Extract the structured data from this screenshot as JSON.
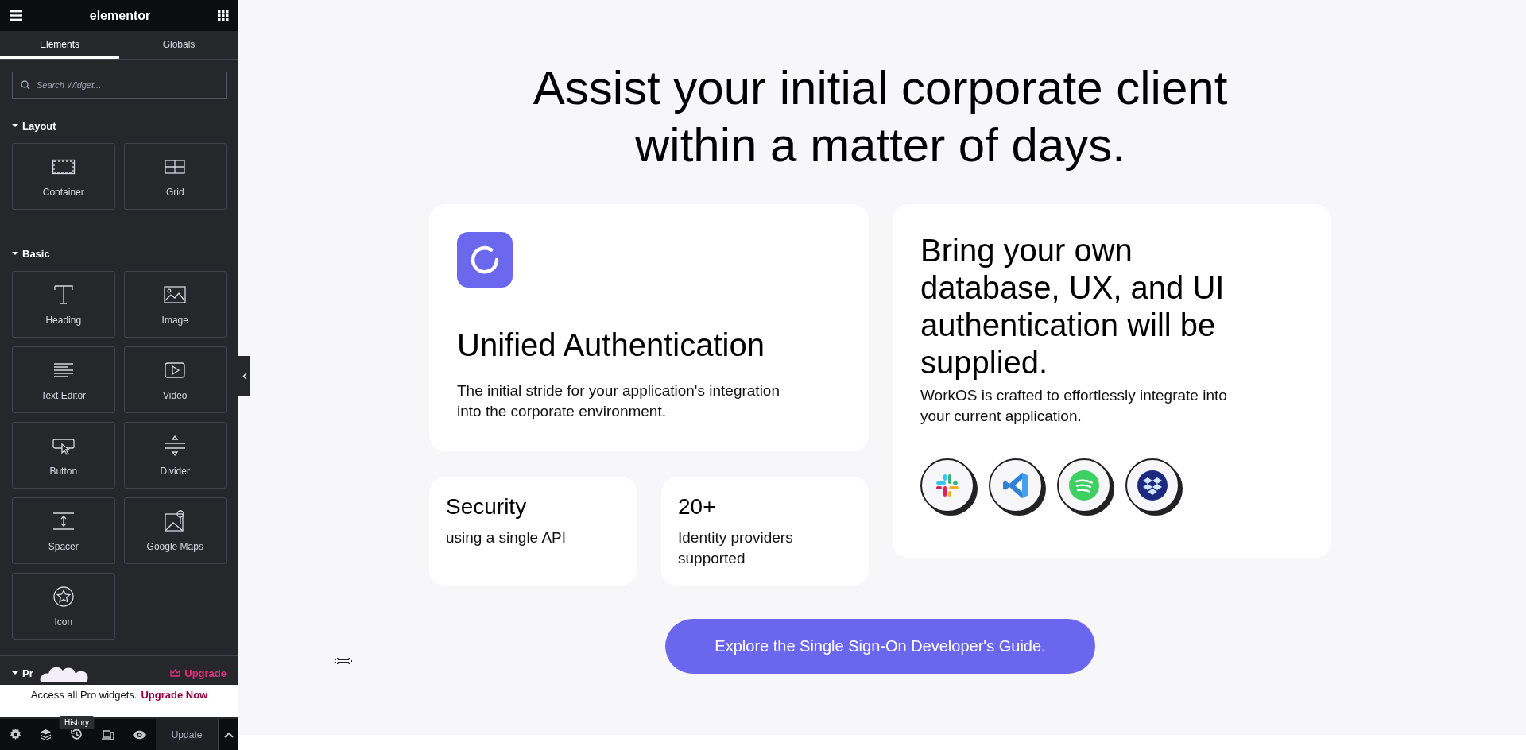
{
  "editor": {
    "logo": "elementor",
    "tabs": [
      {
        "label": "Elements",
        "selected": true
      },
      {
        "label": "Globals",
        "selected": false
      }
    ],
    "search": {
      "placeholder": "Search Widget..."
    },
    "sections": [
      {
        "title": "Layout",
        "expanded": true,
        "widgets": [
          {
            "label": "Container",
            "kind": "container"
          },
          {
            "label": "Grid",
            "kind": "grid"
          }
        ]
      },
      {
        "title": "Basic",
        "expanded": true,
        "widgets": [
          {
            "label": "Heading",
            "kind": "heading"
          },
          {
            "label": "Image",
            "kind": "image"
          },
          {
            "label": "Text Editor",
            "kind": "text"
          },
          {
            "label": "Video",
            "kind": "video"
          },
          {
            "label": "Button",
            "kind": "button"
          },
          {
            "label": "Divider",
            "kind": "divider"
          },
          {
            "label": "Spacer",
            "kind": "spacer"
          },
          {
            "label": "Google Maps",
            "kind": "maps"
          },
          {
            "label": "Icon",
            "kind": "icon"
          }
        ]
      }
    ],
    "pro_section": {
      "title": "Pr",
      "upgrade": "Upgrade"
    },
    "promo": {
      "text": "Access all Pro widgets.",
      "link": "Upgrade Now"
    },
    "tooltip": "History",
    "footer": {
      "update": "Update"
    }
  },
  "page": {
    "headline": "Assist your initial corporate client within a matter of days.",
    "auth_card": {
      "title": "Unified Authentication",
      "text": "The initial stride for your application's integration into the corporate environment."
    },
    "stats": [
      {
        "title": "Security",
        "text": "using a single API"
      },
      {
        "title": "20+",
        "text": "Identity providers supported"
      }
    ],
    "byo_card": {
      "title": "Bring your own database, UX, and UI authentication will be supplied.",
      "text": "WorkOS is crafted to effortlessly integrate into your current application.",
      "apps": [
        {
          "kind": "slack"
        },
        {
          "kind": "vscode"
        },
        {
          "kind": "spotify"
        },
        {
          "kind": "dropbox"
        }
      ]
    },
    "cta": "Explore the Single Sign-On Developer's Guide."
  }
}
